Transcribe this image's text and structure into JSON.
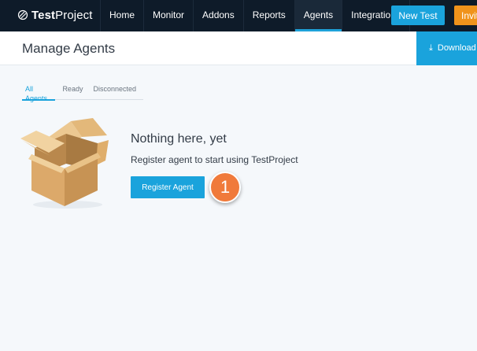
{
  "brand": {
    "name_bold": "Test",
    "name_regular": "Project",
    "logo_icon": "testproject-logo-icon"
  },
  "nav": {
    "items": [
      {
        "label": "Home",
        "active": false
      },
      {
        "label": "Monitor",
        "active": false
      },
      {
        "label": "Addons",
        "active": false
      },
      {
        "label": "Reports",
        "active": false
      },
      {
        "label": "Agents",
        "active": true
      },
      {
        "label": "Integrations",
        "active": false
      }
    ],
    "new_test_label": "New Test",
    "invite_label": "Invite"
  },
  "header": {
    "title": "Manage Agents",
    "download_label": "Download",
    "download_icon": "download-icon"
  },
  "tabs": [
    {
      "label": "All Agents",
      "active": true
    },
    {
      "label": "Ready",
      "active": false
    },
    {
      "label": "Disconnected",
      "active": false
    }
  ],
  "empty_state": {
    "title": "Nothing here, yet",
    "description": "Register agent to start using TestProject",
    "register_label": "Register Agent",
    "illustration_icon": "open-box-icon"
  },
  "step_marker": {
    "number": "1"
  },
  "colors": {
    "nav_bg": "#0e1b29",
    "accent": "#1aa3dc",
    "invite": "#f0931b",
    "marker": "#f07a3b",
    "page_bg": "#f5f8fb"
  }
}
